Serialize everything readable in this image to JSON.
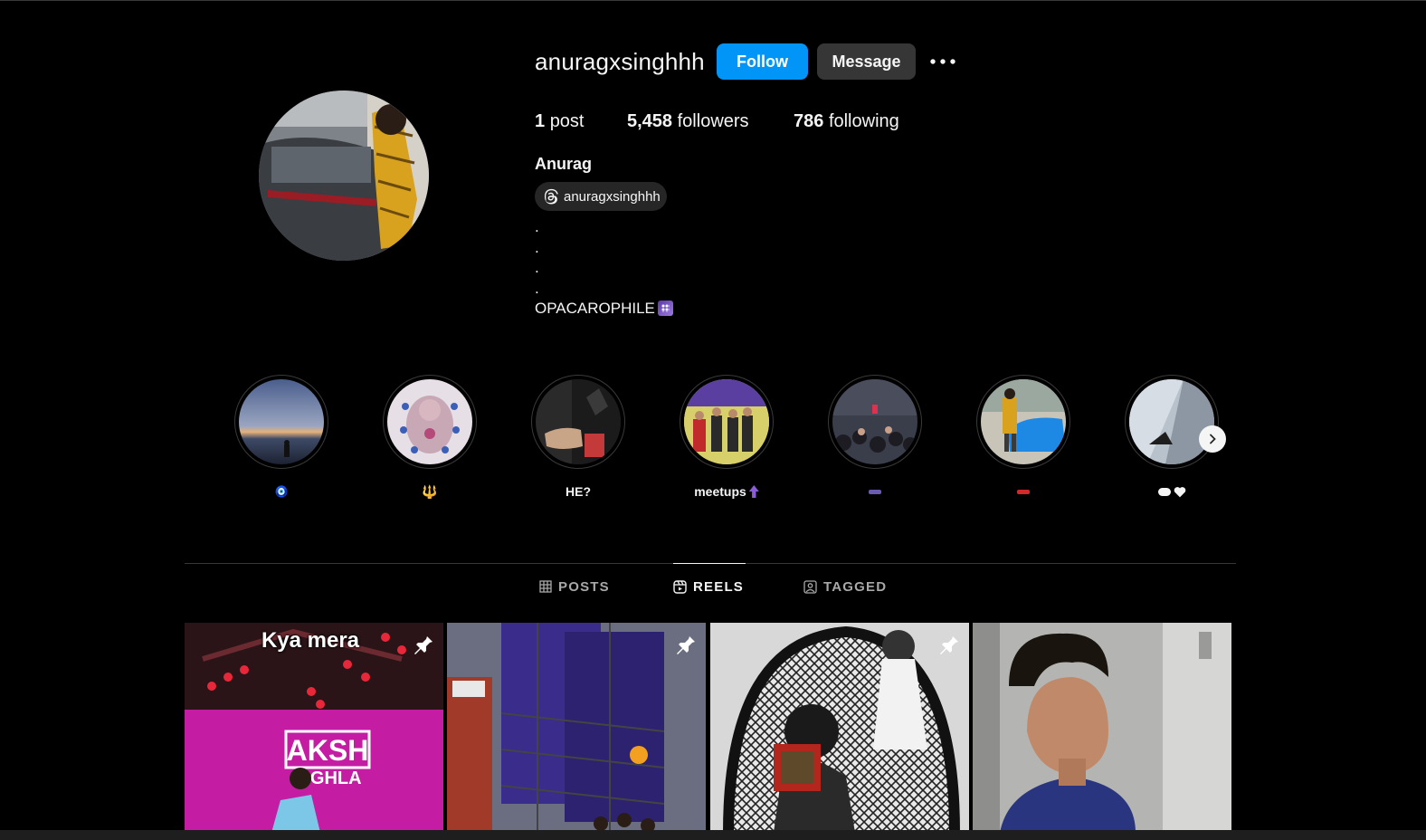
{
  "profile": {
    "username": "anuragxsinghhh",
    "follow_label": "Follow",
    "message_label": "Message",
    "full_name": "Anurag",
    "threads_handle": "anuragxsinghhh",
    "bio_lines": [
      ".",
      ".",
      ".",
      ".",
      "OPACAROPHILE"
    ]
  },
  "stats": {
    "posts_count": "1",
    "posts_label": "post",
    "followers_count": "5,458",
    "followers_label": "followers",
    "following_count": "786",
    "following_label": "following"
  },
  "highlights": [
    {
      "label": "🧿",
      "icon": "nazar-emoji"
    },
    {
      "label": "🔱",
      "icon": "trident-emoji"
    },
    {
      "label": "HE?",
      "icon": ""
    },
    {
      "label": "meetups",
      "icon": "top-arrow-emoji"
    },
    {
      "label": "",
      "icon": "sunglasses-emoji"
    },
    {
      "label": "",
      "icon": "race-car-emoji"
    },
    {
      "label": "",
      "icon": "cloud-heart-emoji"
    }
  ],
  "tabs": [
    {
      "label": "POSTS",
      "icon": "grid-icon",
      "active": false
    },
    {
      "label": "REELS",
      "icon": "reels-icon",
      "active": true
    },
    {
      "label": "TAGGED",
      "icon": "tagged-icon",
      "active": false
    }
  ],
  "reels": [
    {
      "caption": "Kya mera",
      "pinned": true
    },
    {
      "caption": "",
      "pinned": true
    },
    {
      "caption": "",
      "pinned": true
    },
    {
      "caption": "",
      "pinned": false
    }
  ],
  "colors": {
    "accent": "#0095f6",
    "background": "#000000",
    "secondary_button": "#363636"
  }
}
